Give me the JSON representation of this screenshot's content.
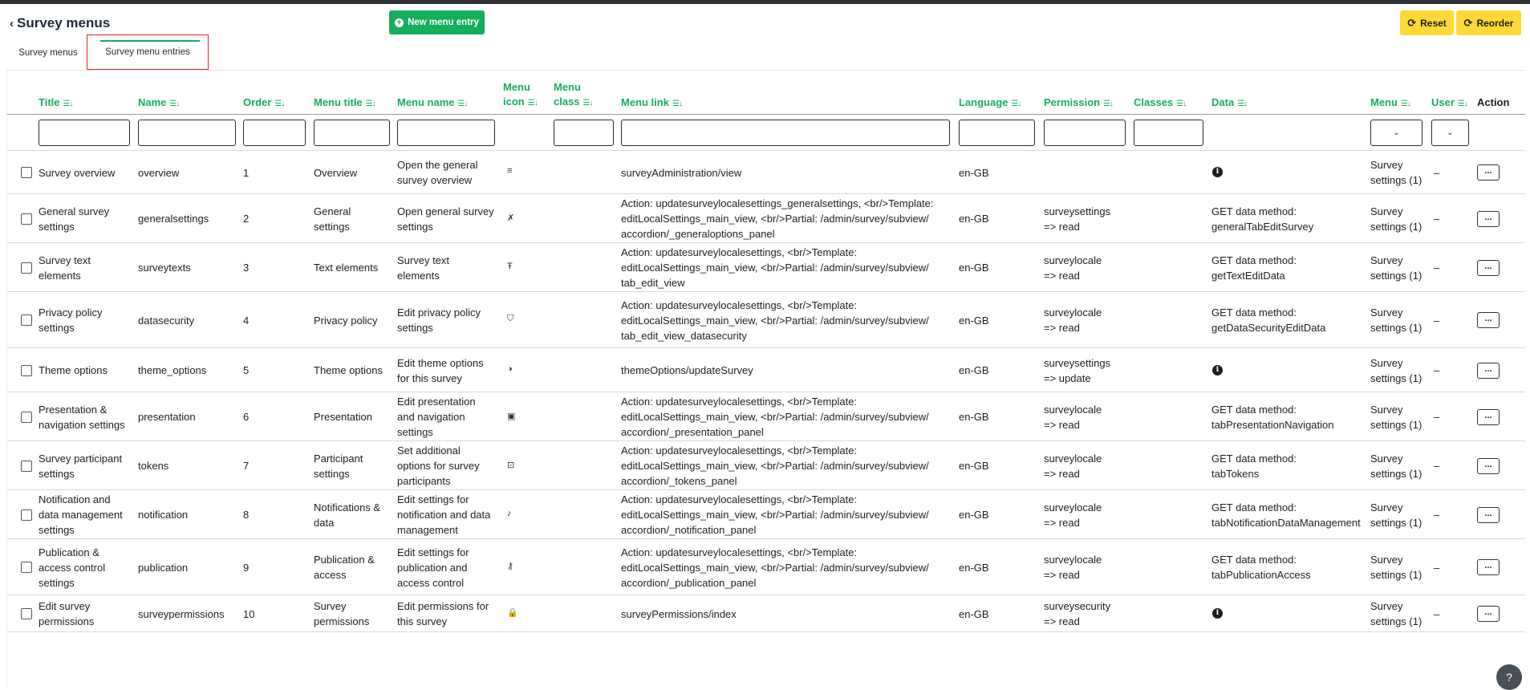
{
  "header": {
    "back_icon": "chevron-left-icon",
    "title": "Survey menus",
    "new_entry_label": "New menu entry",
    "reset_label": "Reset",
    "reorder_label": "Reorder"
  },
  "tabs": [
    {
      "label": "Survey menus",
      "active": false
    },
    {
      "label": "Survey menu entries",
      "active": true
    }
  ],
  "columns": {
    "title": "Title",
    "name": "Name",
    "order": "Order",
    "menu_title": "Menu title",
    "menu_name": "Menu name",
    "menu_icon": [
      "Menu",
      "icon"
    ],
    "menu_class": [
      "Menu",
      "class"
    ],
    "menu_link": "Menu link",
    "language": "Language",
    "permission": "Permission",
    "classes": "Classes",
    "data": "Data",
    "menu": "Menu",
    "user": "User",
    "action": "Action"
  },
  "sort_icon": "sort-icon",
  "rows": [
    {
      "title": [
        "Survey overview"
      ],
      "name": "overview",
      "order": "1",
      "menu_title": [
        "Overview"
      ],
      "menu_name": [
        "Open the general",
        "survey overview"
      ],
      "icon": "list-icon",
      "menu_link": [
        "surveyAdministration/view"
      ],
      "language": "en-GB",
      "permission": [],
      "data": [],
      "data_info": true,
      "menu": [
        "Survey",
        "settings (1)"
      ],
      "user": "–"
    },
    {
      "title": [
        "General survey",
        "settings"
      ],
      "name": "generalsettings",
      "order": "2",
      "menu_title": [
        "General",
        "settings"
      ],
      "menu_name": [
        "Open general survey",
        "settings"
      ],
      "icon": "tools-icon",
      "menu_link": [
        "Action: updatesurveylocalesettings_generalsettings, <br/>Template:",
        "editLocalSettings_main_view, <br/>Partial: /admin/survey/subview/",
        "accordion/_generaloptions_panel"
      ],
      "language": "en-GB",
      "permission": [
        "surveysettings",
        "=> read"
      ],
      "data": [
        "GET data method:",
        "generalTabEditSurvey"
      ],
      "data_info": false,
      "menu": [
        "Survey",
        "settings (1)"
      ],
      "user": "–"
    },
    {
      "title": [
        "Survey text",
        "elements"
      ],
      "name": "surveytexts",
      "order": "3",
      "menu_title": [
        "Text elements"
      ],
      "menu_name": [
        "Survey text",
        "elements"
      ],
      "icon": "text-icon",
      "menu_link": [
        "Action: updatesurveylocalesettings, <br/>Template:",
        "editLocalSettings_main_view, <br/>Partial: /admin/survey/subview/",
        "tab_edit_view"
      ],
      "language": "en-GB",
      "permission": [
        "surveylocale",
        "=> read"
      ],
      "data": [
        "GET data method:",
        "getTextEditData"
      ],
      "data_info": false,
      "menu": [
        "Survey",
        "settings (1)"
      ],
      "user": "–"
    },
    {
      "title": [
        "Privacy policy",
        "settings"
      ],
      "name": "datasecurity",
      "order": "4",
      "menu_title": [
        "Privacy policy"
      ],
      "menu_name": [
        "Edit privacy policy",
        "settings"
      ],
      "icon": "shield-icon",
      "menu_link": [
        "Action: updatesurveylocalesettings, <br/>Template:",
        "editLocalSettings_main_view, <br/>Partial: /admin/survey/subview/",
        "tab_edit_view_datasecurity"
      ],
      "language": "en-GB",
      "permission": [
        "surveylocale",
        "=> read"
      ],
      "data": [
        "GET data method:",
        "getDataSecurityEditData"
      ],
      "data_info": false,
      "menu": [
        "Survey",
        "settings (1)"
      ],
      "user": "–"
    },
    {
      "title": [
        "Theme options"
      ],
      "name": "theme_options",
      "order": "5",
      "menu_title": [
        "Theme options"
      ],
      "menu_name": [
        "Edit theme options",
        "for this survey"
      ],
      "icon": "contrast-icon",
      "menu_link": [
        "themeOptions/updateSurvey"
      ],
      "language": "en-GB",
      "permission": [
        "surveysettings",
        "=> update"
      ],
      "data": [],
      "data_info": true,
      "menu": [
        "Survey",
        "settings (1)"
      ],
      "user": "–"
    },
    {
      "title": [
        "Presentation &",
        "navigation settings"
      ],
      "name": "presentation",
      "order": "6",
      "menu_title": [
        "Presentation"
      ],
      "menu_name": [
        "Edit presentation",
        "and navigation",
        "settings"
      ],
      "icon": "window-icon",
      "menu_link": [
        "Action: updatesurveylocalesettings, <br/>Template:",
        "editLocalSettings_main_view, <br/>Partial: /admin/survey/subview/",
        "accordion/_presentation_panel"
      ],
      "language": "en-GB",
      "permission": [
        "surveylocale",
        "=> read"
      ],
      "data": [
        "GET data method:",
        "tabPresentationNavigation"
      ],
      "data_info": false,
      "menu": [
        "Survey",
        "settings (1)"
      ],
      "user": "–"
    },
    {
      "title": [
        "Survey participant",
        "settings"
      ],
      "name": "tokens",
      "order": "7",
      "menu_title": [
        "Participant",
        "settings"
      ],
      "menu_name": [
        "Set additional",
        "options for survey",
        "participants"
      ],
      "icon": "user-focus-icon",
      "menu_link": [
        "Action: updatesurveylocalesettings, <br/>Template:",
        "editLocalSettings_main_view, <br/>Partial: /admin/survey/subview/",
        "accordion/_tokens_panel"
      ],
      "language": "en-GB",
      "permission": [
        "surveylocale",
        "=> read"
      ],
      "data": [
        "GET data method:",
        "tabTokens"
      ],
      "data_info": false,
      "menu": [
        "Survey",
        "settings (1)"
      ],
      "user": "–"
    },
    {
      "title": [
        "Notification and",
        "data management",
        "settings"
      ],
      "name": "notification",
      "order": "8",
      "menu_title": [
        "Notifications &",
        "data"
      ],
      "menu_name": [
        "Edit settings for",
        "notification and data",
        "management"
      ],
      "icon": "bell-icon",
      "menu_link": [
        "Action: updatesurveylocalesettings, <br/>Template:",
        "editLocalSettings_main_view, <br/>Partial: /admin/survey/subview/",
        "accordion/_notification_panel"
      ],
      "language": "en-GB",
      "permission": [
        "surveylocale",
        "=> read"
      ],
      "data": [
        "GET data method:",
        "tabNotificationDataManagement"
      ],
      "data_info": false,
      "menu": [
        "Survey",
        "settings (1)"
      ],
      "user": "–"
    },
    {
      "title": [
        "Publication &",
        "access control",
        "settings"
      ],
      "name": "publication",
      "order": "9",
      "menu_title": [
        "Publication &",
        "access"
      ],
      "menu_name": [
        "Edit settings for",
        "publication and",
        "access control"
      ],
      "icon": "key-icon",
      "menu_link": [
        "Action: updatesurveylocalesettings, <br/>Template:",
        "editLocalSettings_main_view, <br/>Partial: /admin/survey/subview/",
        "accordion/_publication_panel"
      ],
      "language": "en-GB",
      "permission": [
        "surveylocale",
        "=> read"
      ],
      "data": [
        "GET data method:",
        "tabPublicationAccess"
      ],
      "data_info": false,
      "menu": [
        "Survey",
        "settings (1)"
      ],
      "user": "–"
    },
    {
      "title": [
        "Edit survey",
        "permissions"
      ],
      "name": "surveypermissions",
      "order": "10",
      "menu_title": [
        "Survey",
        "permissions"
      ],
      "menu_name": [
        "Edit permissions for",
        "this survey"
      ],
      "icon": "lock-icon",
      "menu_link": [
        "surveyPermissions/index"
      ],
      "language": "en-GB",
      "permission": [
        "surveysecurity",
        "=> read"
      ],
      "data": [],
      "data_info": true,
      "menu": [
        "Survey",
        "settings (1)"
      ],
      "user": "–"
    }
  ],
  "action_label": "...",
  "help_icon": "help-chat-icon",
  "colors": {
    "accent_green": "#14ae5c",
    "button_yellow": "#ffd935",
    "active_tab_border": "#e8202a"
  }
}
